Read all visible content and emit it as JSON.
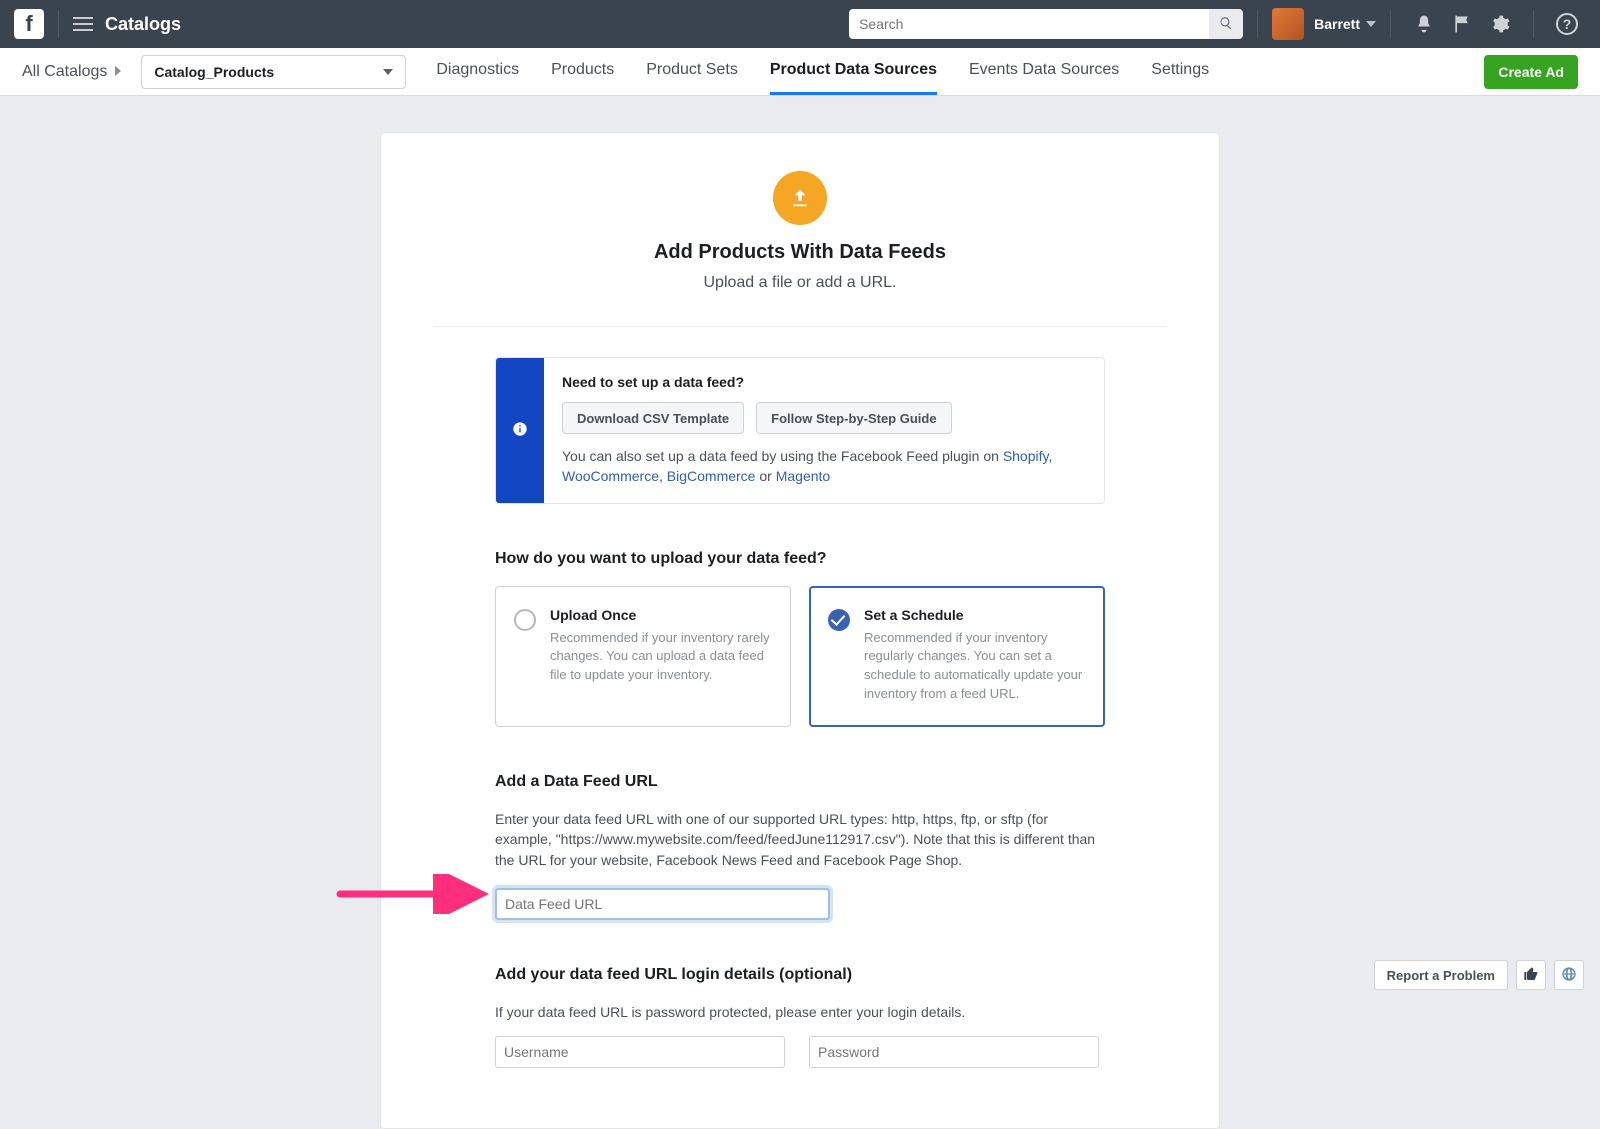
{
  "topbar": {
    "brand": "Catalogs",
    "search_placeholder": "Search",
    "username": "Barrett"
  },
  "subbar": {
    "breadcrumb": "All Catalogs",
    "catalog_name": "Catalog_Products",
    "tabs": [
      "Diagnostics",
      "Products",
      "Product Sets",
      "Product Data Sources",
      "Events Data Sources",
      "Settings"
    ],
    "active_tab_index": 3,
    "create_ad": "Create Ad"
  },
  "hero": {
    "title": "Add Products With Data Feeds",
    "subtitle": "Upload a file or add a URL."
  },
  "infobox": {
    "heading": "Need to set up a data feed?",
    "btn_csv": "Download CSV Template",
    "btn_guide": "Follow Step-by-Step Guide",
    "lead": "You can also set up a data feed by using the Facebook Feed plugin on ",
    "link_shopify": "Shopify",
    "link_woo": "WooCommerce",
    "link_big": "BigCommerce",
    "or": " or ",
    "link_magento": "Magento"
  },
  "how": {
    "heading": "How do you want to upload your data feed?",
    "options": [
      {
        "title": "Upload Once",
        "desc": "Recommended if your inventory rarely changes. You can upload a data feed file to update your inventory."
      },
      {
        "title": "Set a Schedule",
        "desc": "Recommended if your inventory regularly changes. You can set a schedule to automatically update your inventory from a feed URL."
      }
    ],
    "selected_index": 1
  },
  "url_section": {
    "heading": "Add a Data Feed URL",
    "desc": "Enter your data feed URL with one of our supported URL types: http, https, ftp, or sftp (for example, \"https://www.mywebsite.com/feed/feedJune112917.csv\"). Note that this is different than the URL for your website, Facebook News Feed and Facebook Page Shop.",
    "placeholder": "Data Feed URL"
  },
  "login_section": {
    "heading": "Add your data feed URL login details (optional)",
    "desc": "If your data feed URL is password protected, please enter your login details.",
    "user_ph": "Username",
    "pass_ph": "Password"
  },
  "bottom": {
    "report": "Report a Problem"
  }
}
